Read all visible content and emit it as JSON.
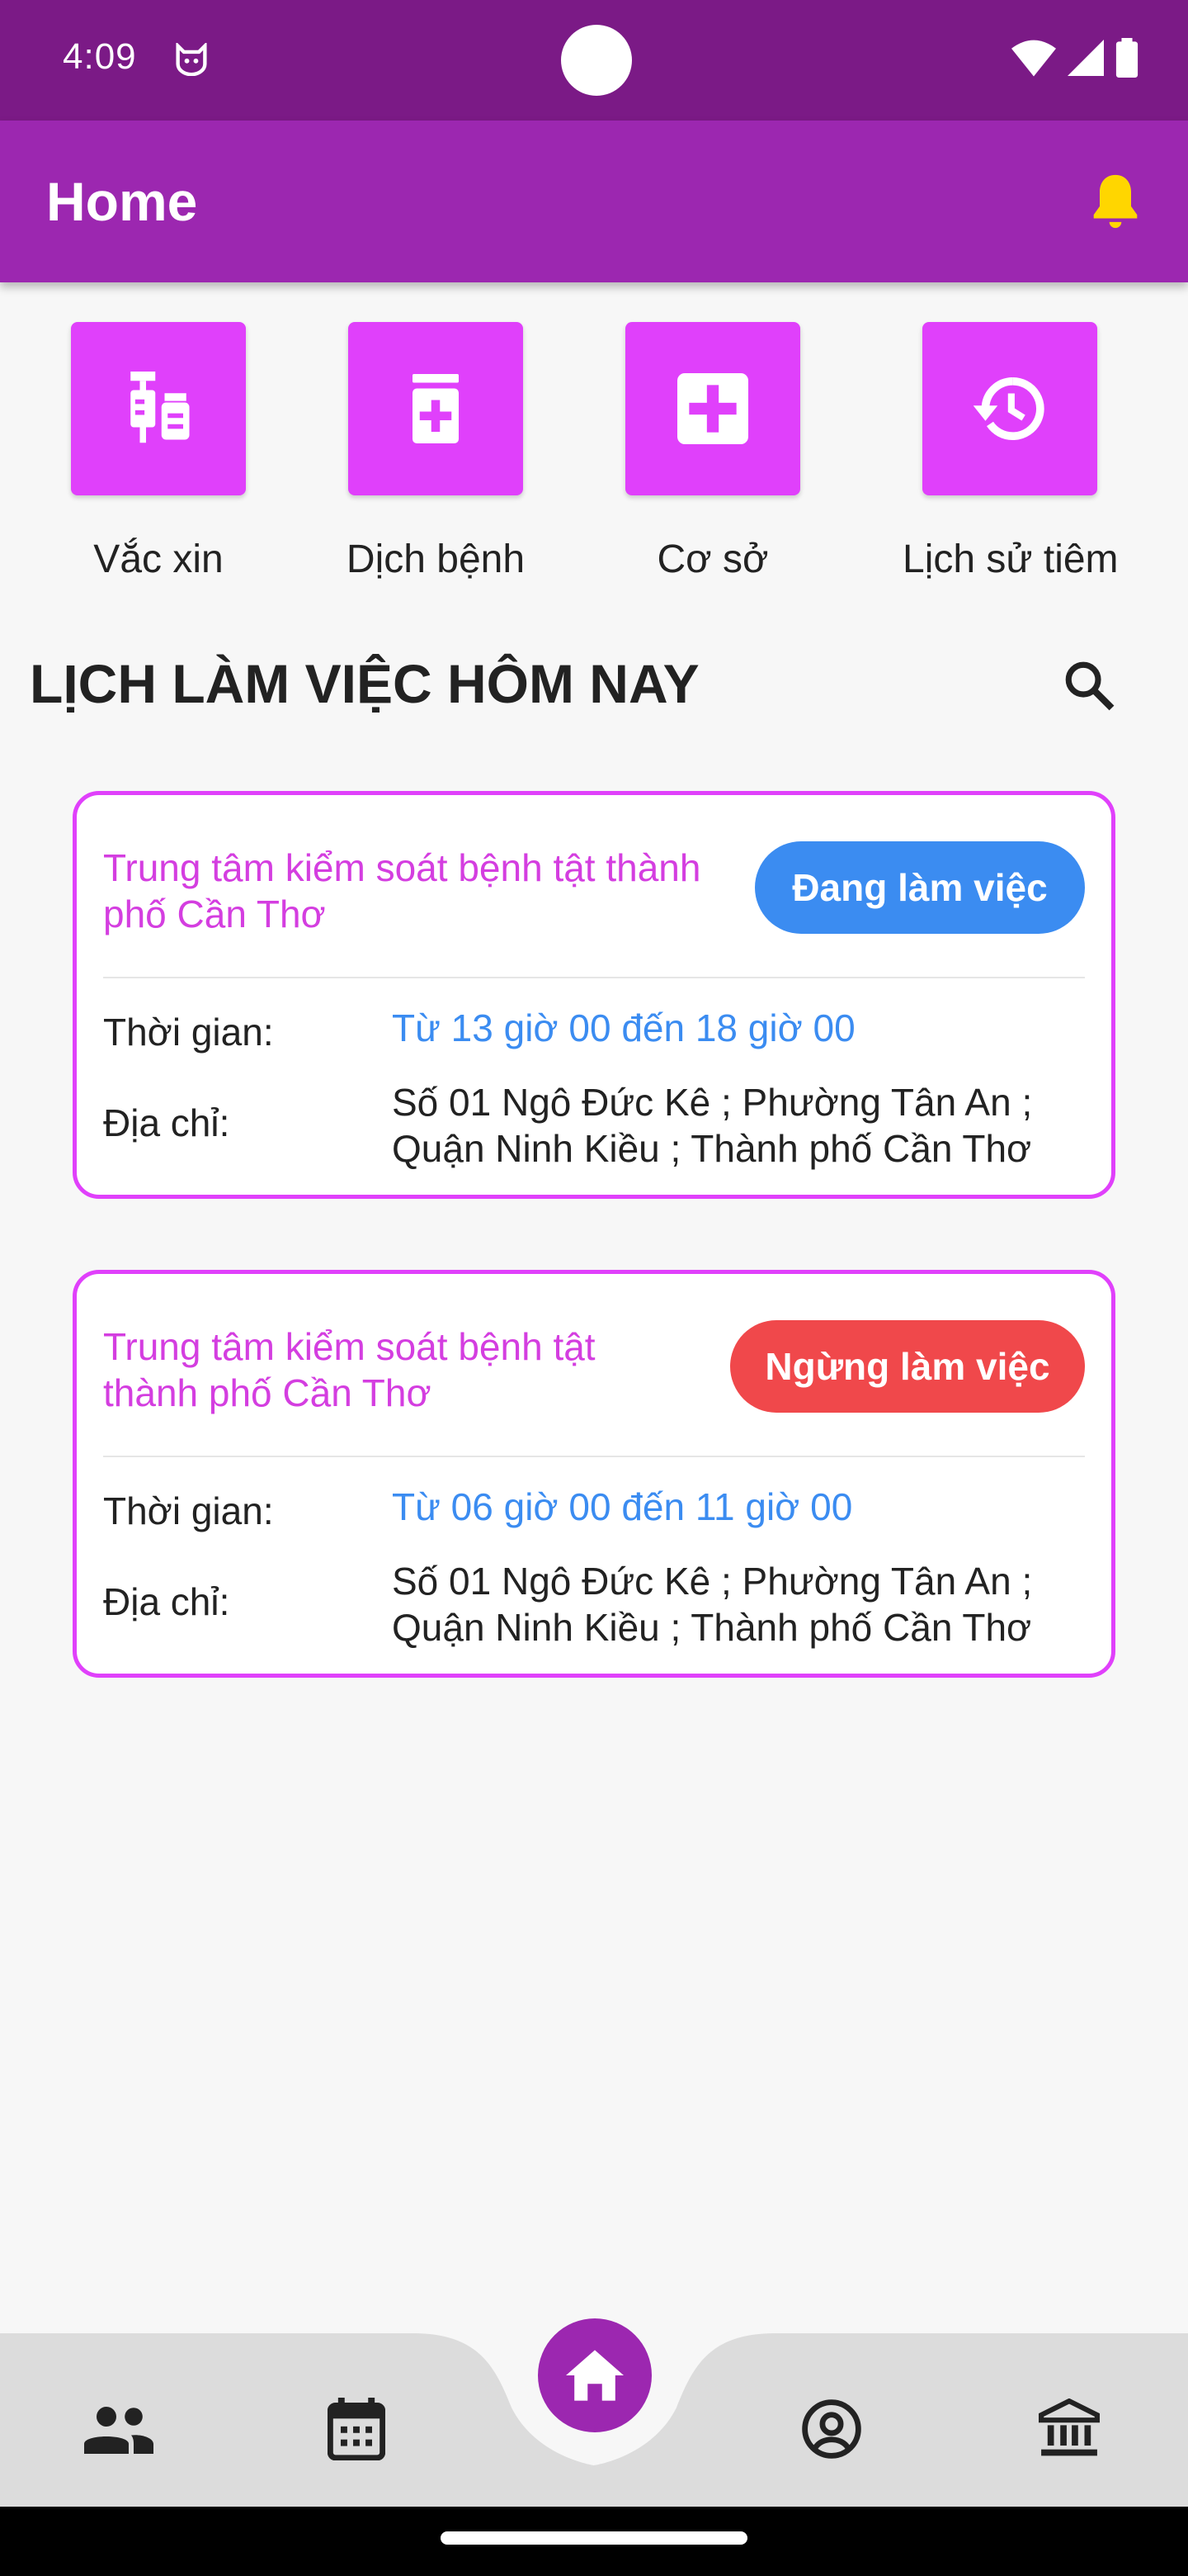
{
  "status_bar": {
    "time": "4:09"
  },
  "app_bar": {
    "title": "Home"
  },
  "quick_actions": [
    {
      "label": "Vắc xin",
      "icon": "vaccine-icon"
    },
    {
      "label": "Dịch bệnh",
      "icon": "medicine-bottle-icon"
    },
    {
      "label": "Cơ sở",
      "icon": "medical-plus-icon"
    },
    {
      "label": "Lịch sử tiêm",
      "icon": "history-icon"
    }
  ],
  "section": {
    "title": "LỊCH LÀM VIỆC HÔM NAY"
  },
  "schedules": [
    {
      "name": "Trung tâm kiểm soát bệnh tật thành phố Cần Thơ",
      "status": "Đang làm việc",
      "time_label": "Thời gian:",
      "time_value": "Từ 13 giờ 00  đến 18 giờ 00",
      "address_label": "Địa chỉ:",
      "address_line1": "Số 01 Ngô Đức Kê ; Phường Tân An ;",
      "address_line2": "Quận Ninh Kiều ; Thành phố Cần Thơ"
    },
    {
      "name": "Trung tâm kiểm soát bệnh tật thành phố Cần Thơ",
      "status": "Ngừng làm việc",
      "time_label": "Thời gian:",
      "time_value": "Từ 06 giờ 00  đến 11 giờ 00",
      "address_label": "Địa chỉ:",
      "address_line1": "Số 01 Ngô Đức Kê ; Phường Tân An ;",
      "address_line2": "Quận Ninh Kiều ; Thành phố Cần Thơ"
    }
  ],
  "bottom_nav": [
    {
      "icon": "people-icon"
    },
    {
      "icon": "calendar-icon"
    },
    {
      "icon": "home-icon",
      "active": true
    },
    {
      "icon": "account-circle-icon"
    },
    {
      "icon": "bank-icon"
    }
  ],
  "colors": {
    "primary": "#9c27b0",
    "status_bar": "#7b1a86",
    "accent": "#e040fb",
    "active_blue": "#3b8cf1",
    "inactive_red": "#f0484b",
    "bell": "#ffd600"
  }
}
